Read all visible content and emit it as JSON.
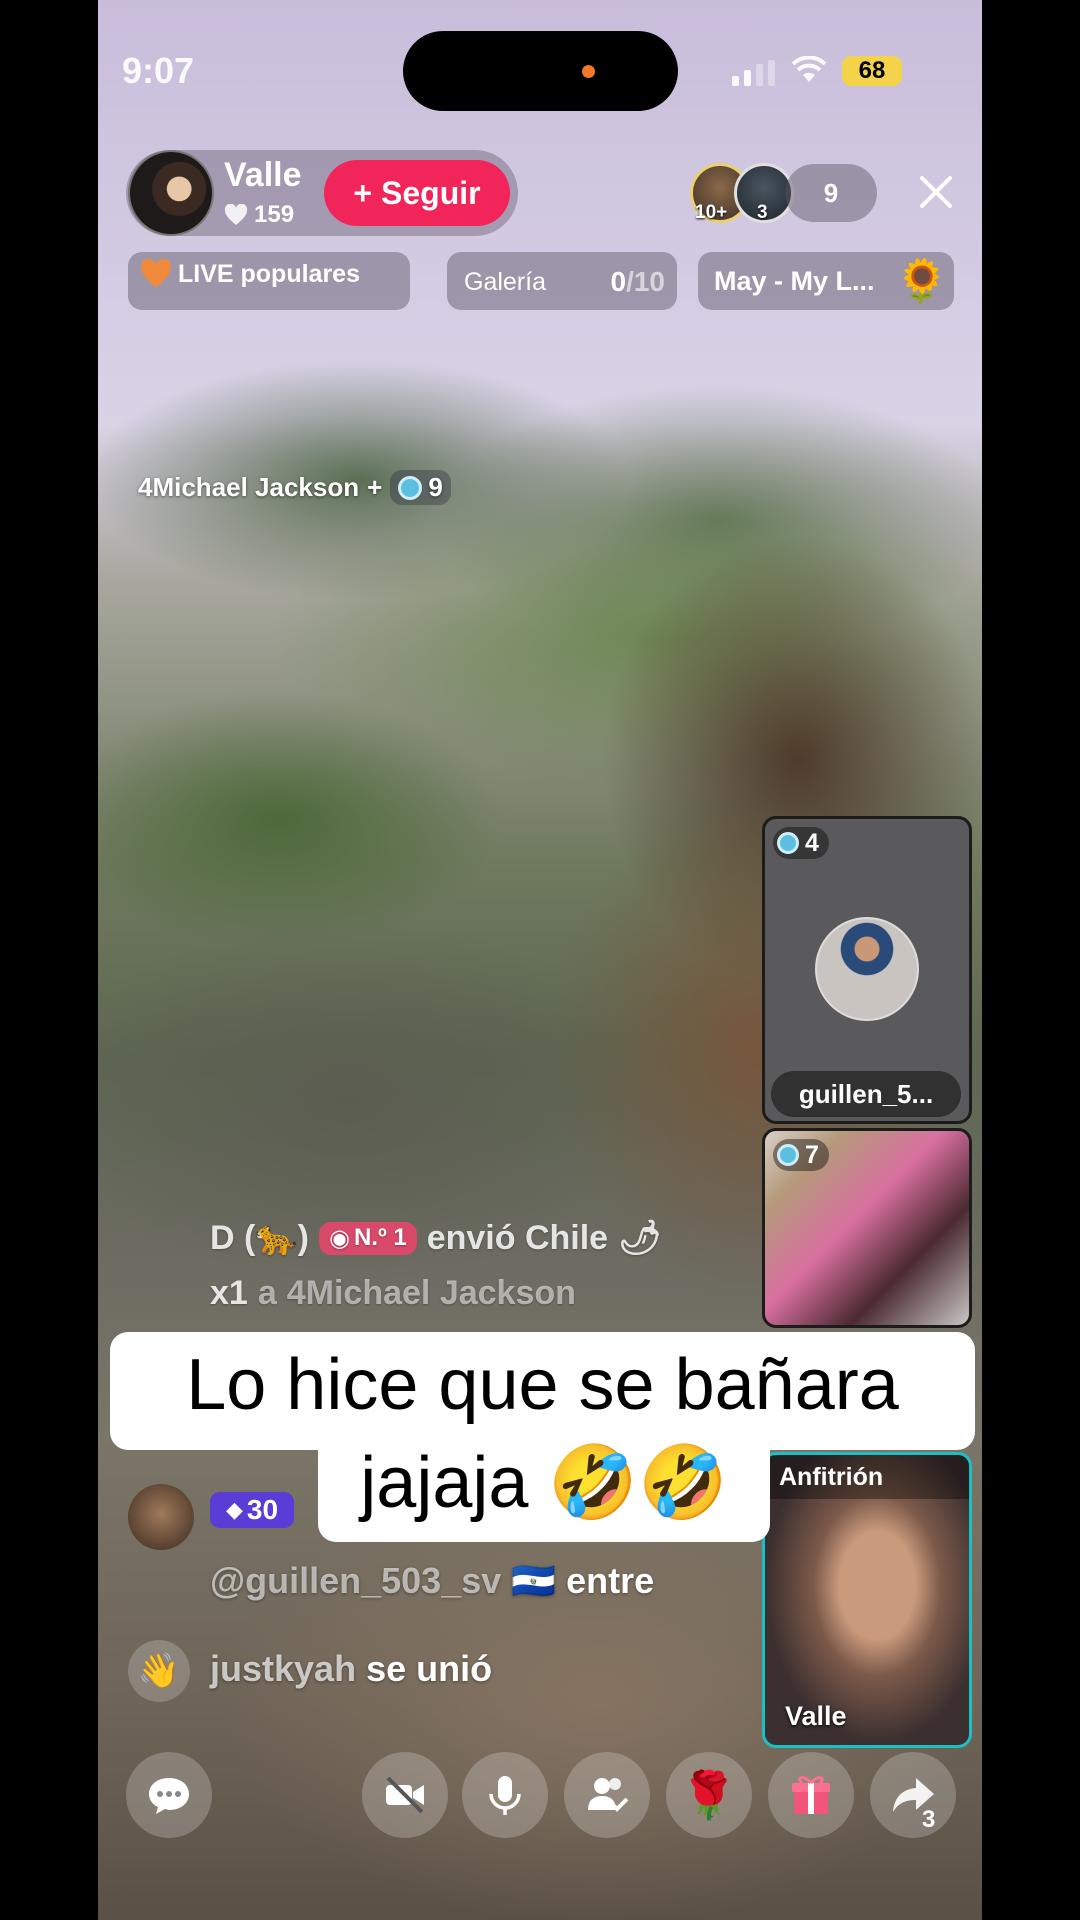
{
  "status_bar": {
    "time": "9:07",
    "battery": "68"
  },
  "host": {
    "name": "Valle",
    "likes": "159",
    "follow_label": "+ Seguir"
  },
  "viewers": {
    "badge1": "10+",
    "badge2": "3",
    "count": "9"
  },
  "chips": {
    "live_popular": "LIVE populares",
    "gallery_label": "Galería",
    "gallery_count": "0",
    "gallery_total": "/10",
    "song": "May - My L..."
  },
  "guest": {
    "name": "4Michael Jackson",
    "plus": "+",
    "level": "9"
  },
  "tiles": [
    {
      "level": "4",
      "name": "guillen_5..."
    },
    {
      "level": "7"
    },
    {
      "host_label": "Anfitrión",
      "name": "Valle"
    }
  ],
  "gift": {
    "sender": "D (🐆)",
    "rank": "N.º 1",
    "action": "envió Chile",
    "qty": "x1",
    "to": "a",
    "recipient": "4Michael Jackson"
  },
  "caption": {
    "line1": "Lo hice que se bañara",
    "line2": "jajaja 🤣🤣"
  },
  "chat": [
    {
      "badge": "30"
    },
    {
      "user": "@guillen_503_sv",
      "flag": "🇸🇻",
      "text": "entre"
    },
    {
      "user": "justkyah",
      "text": "se unió"
    }
  ],
  "bottom_bar": {
    "share_count": "3"
  },
  "colors": {
    "follow": "#f2255a",
    "battery": "#f3d34a",
    "host_tile_border": "#1bc0c4",
    "badge_purple": "#5a3cd6"
  }
}
